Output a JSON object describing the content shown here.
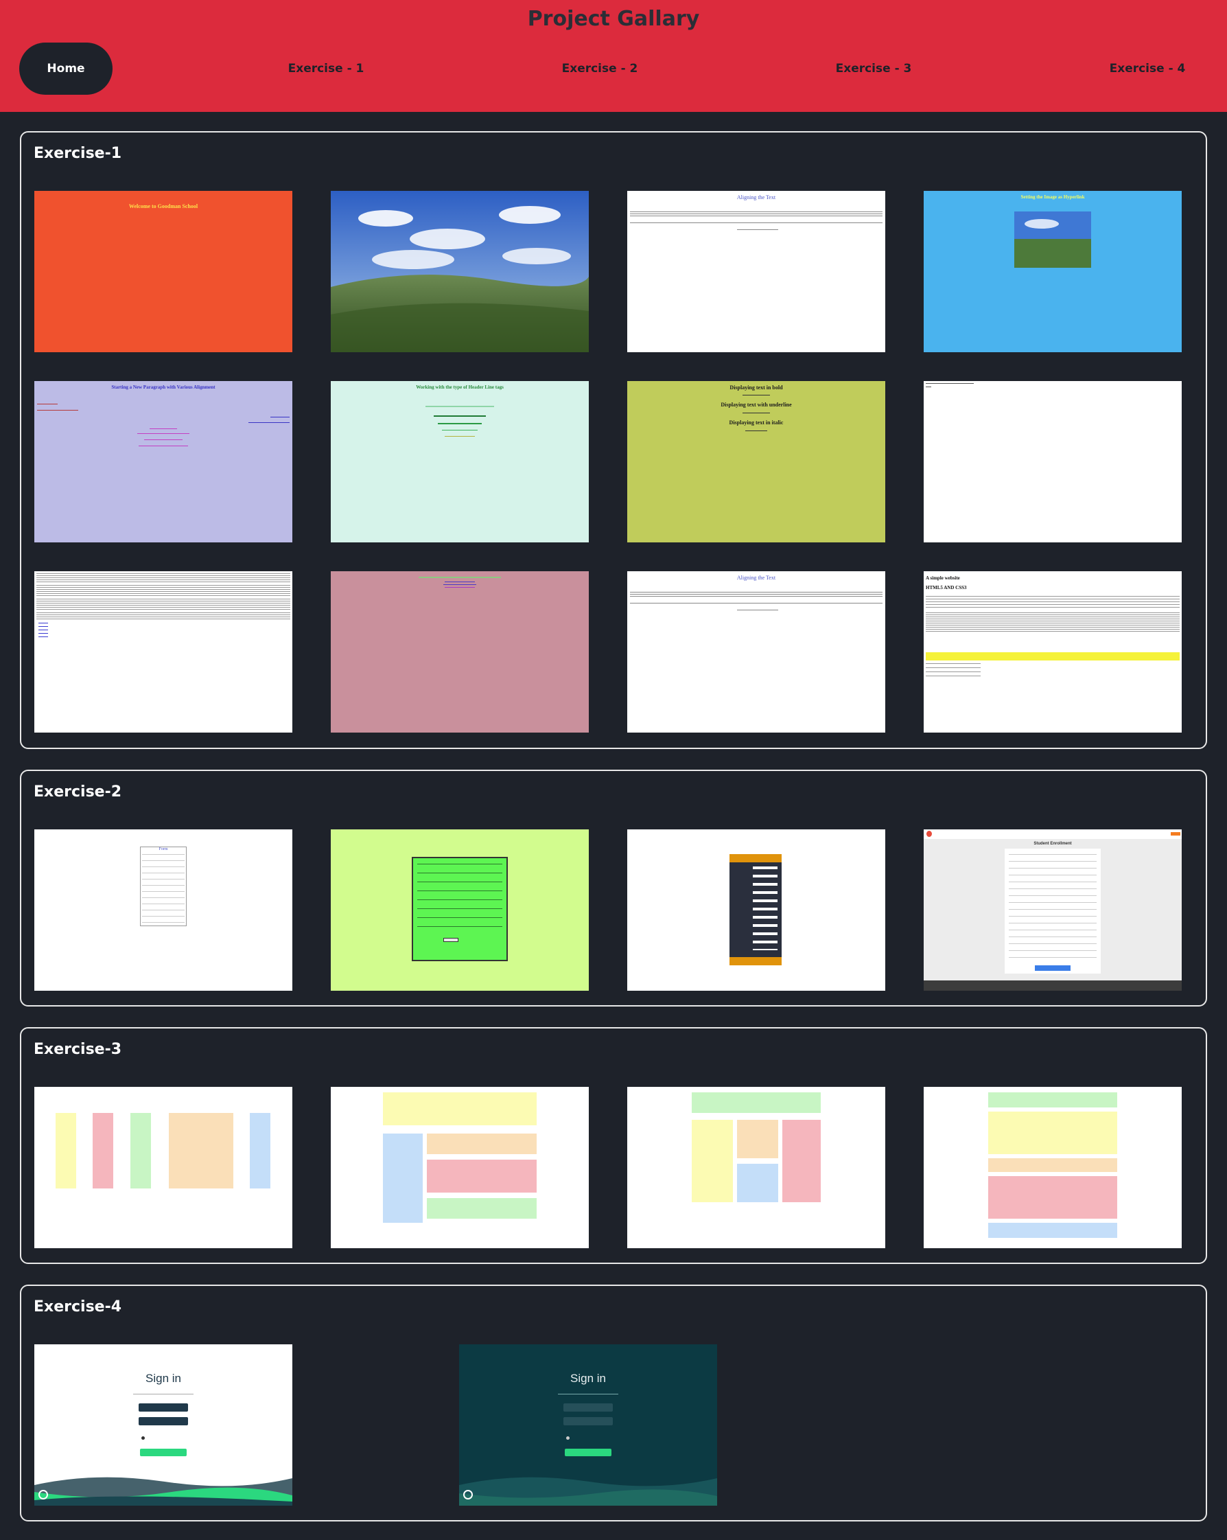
{
  "header": {
    "title": "Project Gallary",
    "nav": [
      {
        "label": "Home"
      },
      {
        "label": "Exercise - 1"
      },
      {
        "label": "Exercise - 2"
      },
      {
        "label": "Exercise - 3"
      },
      {
        "label": "Exercise - 4"
      }
    ]
  },
  "sections": [
    {
      "title": "Exercise-1",
      "thumbs": [
        {
          "caption": "Welcome to Goodman School",
          "bg": "#f0522e"
        },
        {
          "caption": "",
          "bg": "#5b8fd6"
        },
        {
          "caption": "Aligning the Text",
          "bg": "#ffffff"
        },
        {
          "caption": "Setting the Image as Hyperlink",
          "bg": "#4ab3ee"
        },
        {
          "caption": "Starting a New Paragraph with Various Alignment",
          "bg": "#bcbbe6"
        },
        {
          "caption": "Working with the type of Header Line tags",
          "bg": "#d6f3ea"
        },
        {
          "caption": "Displaying text in bold",
          "sub1": "Displaying text with underline",
          "sub2": "Displaying text in italic",
          "bg": "#c0cc5b"
        },
        {
          "caption": "",
          "bg": "#ffffff"
        },
        {
          "caption": "",
          "bg": "#ffffff"
        },
        {
          "caption": "",
          "bg": "#c9909c"
        },
        {
          "caption": "Aligning the Text",
          "bg": "#ffffff"
        },
        {
          "caption": "A simple website",
          "sub1": "HTML5 AND CSS3",
          "bg": "#ffffff"
        }
      ]
    },
    {
      "title": "Exercise-2",
      "thumbs": [
        {
          "caption": "Form",
          "bg": "#ffffff"
        },
        {
          "caption": "",
          "bg": "#d2fc8e"
        },
        {
          "caption": "",
          "bg": "#ffffff"
        },
        {
          "caption": "Student Enrollment",
          "bg": "#ececec"
        }
      ]
    },
    {
      "title": "Exercise-3",
      "thumbs": [
        {
          "caption": "",
          "bg": "#ffffff"
        },
        {
          "caption": "",
          "bg": "#ffffff"
        },
        {
          "caption": "",
          "bg": "#ffffff"
        },
        {
          "caption": "",
          "bg": "#ffffff"
        }
      ]
    },
    {
      "title": "Exercise-4",
      "thumbs": [
        {
          "caption": "Sign in",
          "bg": "#ffffff"
        },
        {
          "caption": "Sign in",
          "bg": "#0c3a43"
        }
      ]
    }
  ],
  "colors": {
    "header": "#dc2b3d",
    "page": "#1e222a",
    "accent": "#2bd87f"
  }
}
